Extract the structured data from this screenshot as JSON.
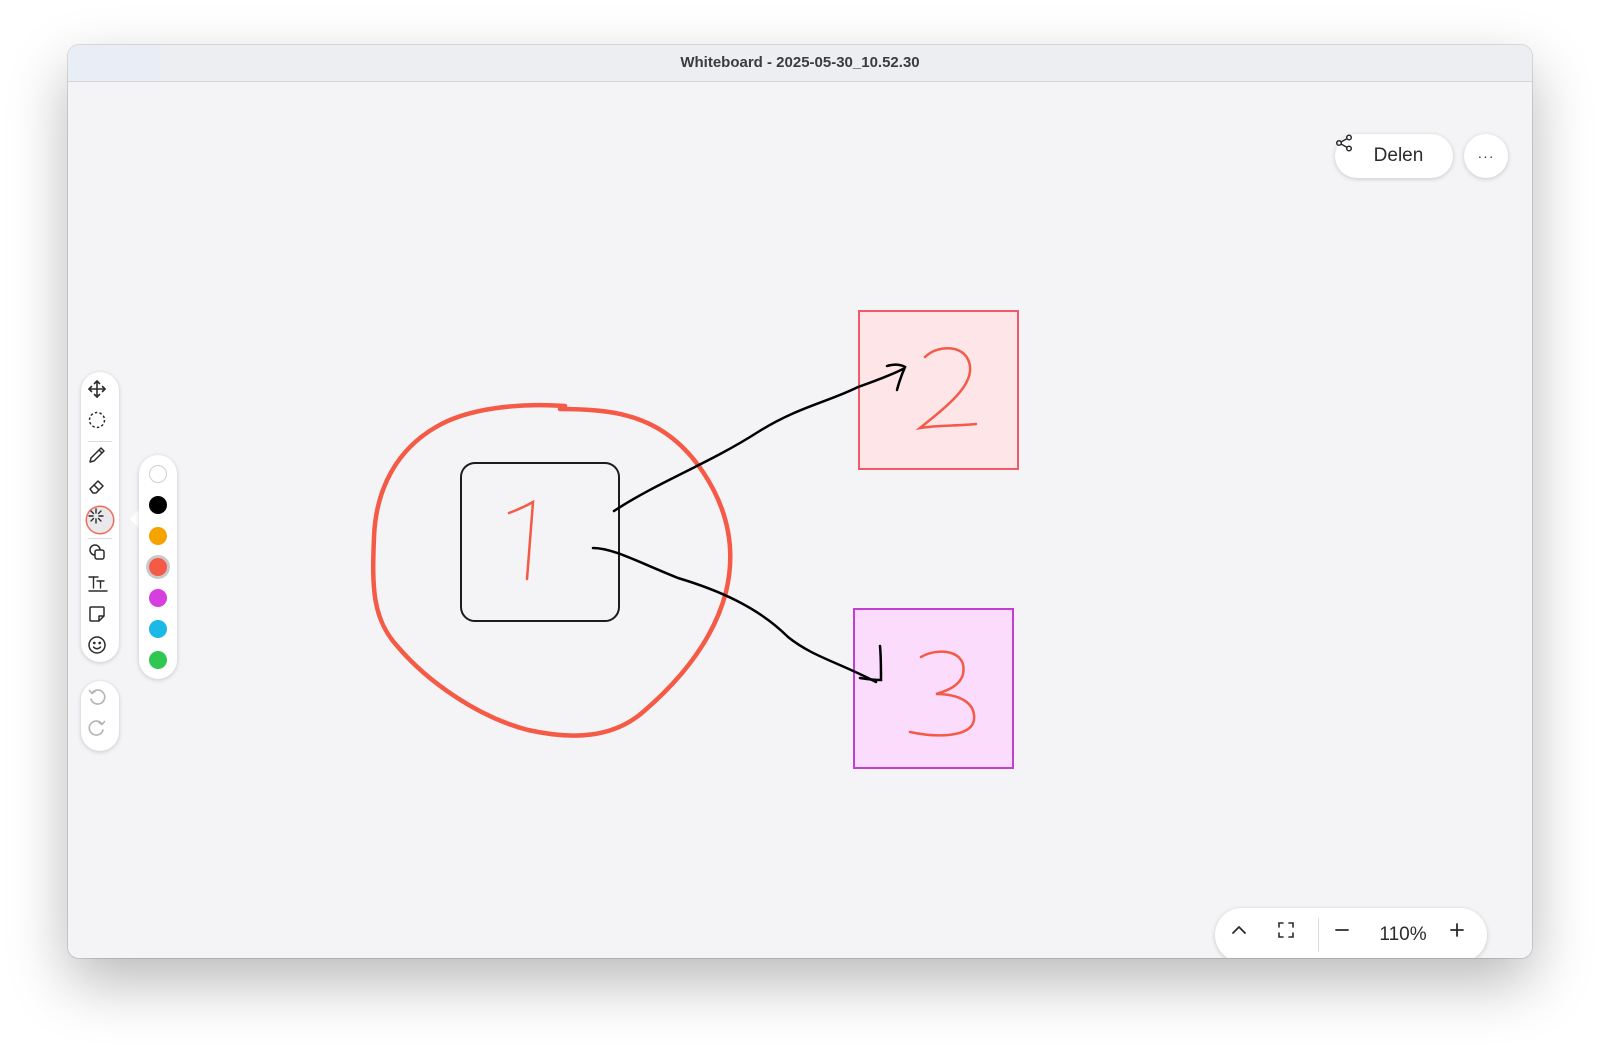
{
  "window": {
    "title": "Whiteboard - 2025-05-30_10.52.30"
  },
  "header": {
    "share_label": "Delen",
    "more_label": "···"
  },
  "toolbar": {
    "tools": [
      "move-icon",
      "lasso-select-icon",
      "pen-icon",
      "eraser-icon",
      "laser-pointer-icon",
      "shapes-icon",
      "text-icon",
      "sticky-note-icon",
      "emoji-icon"
    ],
    "active_tool": "laser-pointer-icon",
    "history": [
      "undo-icon",
      "redo-icon"
    ]
  },
  "palette": {
    "colors": [
      "#ffffff",
      "#000000",
      "#f5a300",
      "#f55a47",
      "#d63ee0",
      "#1cb8e8",
      "#2fc752"
    ],
    "selected": "#f55a47"
  },
  "board": {
    "shapes": [
      {
        "label": "1",
        "stroke": "#1c1c1e",
        "fill": "transparent",
        "label_color": "#f55a47"
      },
      {
        "label": "2",
        "stroke": "#f05a6a",
        "fill": "#fde5e8",
        "label_color": "#f55a47"
      },
      {
        "label": "3",
        "stroke": "#c43ed4",
        "fill": "#fbdcfc",
        "label_color": "#f55a47"
      }
    ],
    "ink_color": "#f55a47",
    "arrow_color": "#000000"
  },
  "zoom": {
    "level": "110%",
    "controls": [
      "collapse-icon",
      "fit-screen-icon",
      "zoom-out-icon",
      "zoom-in-icon"
    ]
  }
}
